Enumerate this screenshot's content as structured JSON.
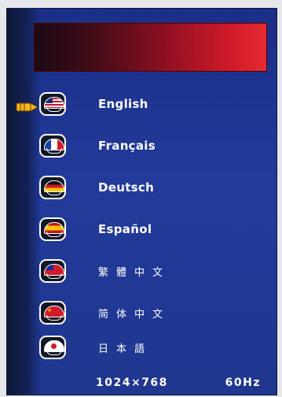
{
  "languages": [
    {
      "label": "English",
      "flag": "us-flag-icon"
    },
    {
      "label": "Français",
      "flag": "france-flag-icon"
    },
    {
      "label": "Deutsch",
      "flag": "germany-flag-icon"
    },
    {
      "label": "Español",
      "flag": "spain-flag-icon"
    },
    {
      "label": "繁體中文",
      "flag": "taiwan-flag-icon"
    },
    {
      "label": "简体中文",
      "flag": "china-flag-icon"
    },
    {
      "label": "日本語",
      "flag": "japan-flag-icon"
    }
  ],
  "selected_index": 0,
  "status": {
    "resolution": "1024×768",
    "refresh": "60Hz"
  },
  "colors": {
    "panel": "#1f3590",
    "header": "#d21a2a",
    "text": "#ffffff",
    "pointer": "#f0b81c"
  }
}
